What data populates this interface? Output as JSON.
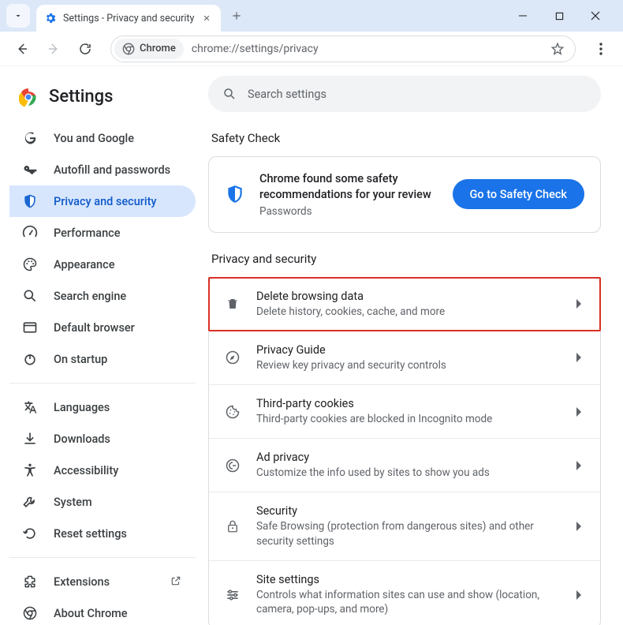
{
  "window": {
    "tab_title": "Settings - Privacy and security"
  },
  "toolbar": {
    "chrome_chip": "Chrome",
    "url": "chrome://settings/privacy"
  },
  "sidebar": {
    "title": "Settings",
    "items": [
      {
        "label": "You and Google"
      },
      {
        "label": "Autofill and passwords"
      },
      {
        "label": "Privacy and security"
      },
      {
        "label": "Performance"
      },
      {
        "label": "Appearance"
      },
      {
        "label": "Search engine"
      },
      {
        "label": "Default browser"
      },
      {
        "label": "On startup"
      }
    ],
    "items2": [
      {
        "label": "Languages"
      },
      {
        "label": "Downloads"
      },
      {
        "label": "Accessibility"
      },
      {
        "label": "System"
      },
      {
        "label": "Reset settings"
      }
    ],
    "items3": [
      {
        "label": "Extensions"
      },
      {
        "label": "About Chrome"
      }
    ]
  },
  "main": {
    "search_placeholder": "Search settings",
    "safety_check": {
      "heading": "Safety Check",
      "card_title": "Chrome found some safety recommendations for your review",
      "card_sub": "Passwords",
      "button": "Go to Safety Check"
    },
    "privacy": {
      "heading": "Privacy and security",
      "rows": [
        {
          "title": "Delete browsing data",
          "sub": "Delete history, cookies, cache, and more"
        },
        {
          "title": "Privacy Guide",
          "sub": "Review key privacy and security controls"
        },
        {
          "title": "Third-party cookies",
          "sub": "Third-party cookies are blocked in Incognito mode"
        },
        {
          "title": "Ad privacy",
          "sub": "Customize the info used by sites to show you ads"
        },
        {
          "title": "Security",
          "sub": "Safe Browsing (protection from dangerous sites) and other security settings"
        },
        {
          "title": "Site settings",
          "sub": "Controls what information sites can use and show (location, camera, pop-ups, and more)"
        }
      ]
    }
  }
}
